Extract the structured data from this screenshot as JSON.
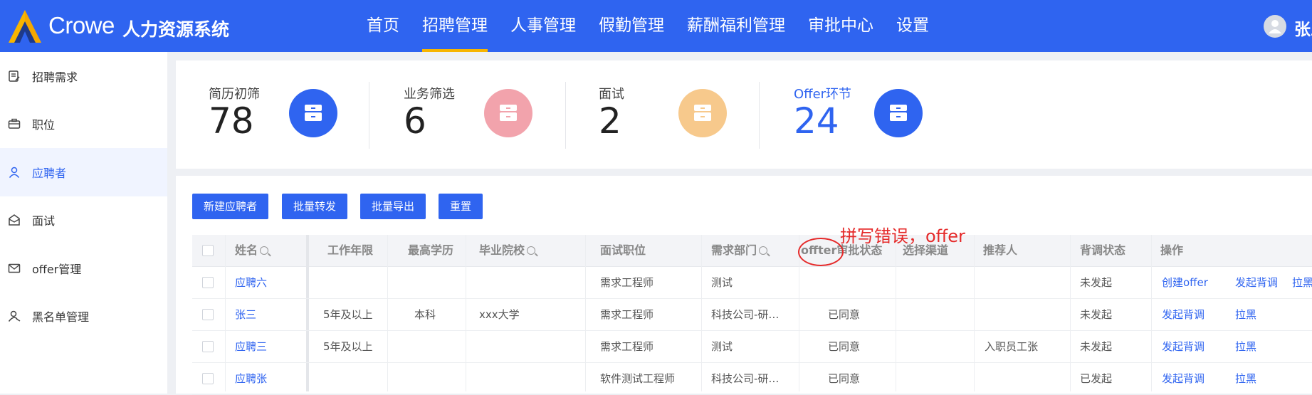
{
  "header": {
    "brand": "Crowe",
    "system_name": "人力资源系统",
    "nav": [
      "首页",
      "招聘管理",
      "人事管理",
      "假勤管理",
      "薪酬福利管理",
      "审批中心",
      "设置"
    ],
    "active_nav": "招聘管理",
    "username": "张三"
  },
  "sidebar": {
    "items": [
      {
        "label": "招聘需求",
        "icon": "document-edit-icon"
      },
      {
        "label": "职位",
        "icon": "briefcase-icon"
      },
      {
        "label": "应聘者",
        "icon": "user-icon",
        "active": true
      },
      {
        "label": "面试",
        "icon": "mail-open-icon"
      },
      {
        "label": "offer管理",
        "icon": "envelope-icon"
      },
      {
        "label": "黑名单管理",
        "icon": "user-block-icon"
      }
    ]
  },
  "stats": [
    {
      "label": "简历初筛",
      "value": "78",
      "color": "#2f64f0"
    },
    {
      "label": "业务筛选",
      "value": "6",
      "color": "#f2a3ac"
    },
    {
      "label": "面试",
      "value": "2",
      "color": "#f7c98c"
    },
    {
      "label": "Offer环节",
      "value": "24",
      "color": "#2f64f0"
    }
  ],
  "toolbar": {
    "buttons": [
      "新建应聘者",
      "批量转发",
      "批量导出",
      "重置"
    ]
  },
  "table": {
    "columns": [
      "姓名",
      "工作年限",
      "最高学历",
      "毕业院校",
      "面试职位",
      "需求部门",
      "offter审批状态",
      "选择渠道",
      "推荐人",
      "背调状态",
      "操作"
    ],
    "rows": [
      {
        "name": "应聘六",
        "years": "",
        "edu": "",
        "school": "",
        "position": "需求工程师",
        "dept": "测试",
        "offer_status": "",
        "channel": "",
        "referrer": "",
        "bg_status": "未发起",
        "actions": [
          "创建offer",
          "发起背调",
          "拉黑"
        ]
      },
      {
        "name": "张三",
        "years": "5年及以上",
        "edu": "本科",
        "school": "xxx大学",
        "position": "需求工程师",
        "dept": "科技公司-研…",
        "offer_status": "已同意",
        "channel": "",
        "referrer": "",
        "bg_status": "未发起",
        "actions": [
          "发起背调",
          "拉黑"
        ]
      },
      {
        "name": "应聘三",
        "years": "5年及以上",
        "edu": "",
        "school": "",
        "position": "需求工程师",
        "dept": "测试",
        "offer_status": "已同意",
        "channel": "",
        "referrer": "入职员工张",
        "bg_status": "未发起",
        "actions": [
          "发起背调",
          "拉黑"
        ]
      },
      {
        "name": "应聘张",
        "years": "",
        "edu": "",
        "school": "",
        "position": "软件测试工程师",
        "dept": "科技公司-研…",
        "offer_status": "已同意",
        "channel": "",
        "referrer": "",
        "bg_status": "已发起",
        "actions": [
          "发起背调",
          "拉黑"
        ]
      }
    ]
  },
  "annotation": {
    "text": "拼写错误，offer",
    "color": "#e52a2a"
  }
}
